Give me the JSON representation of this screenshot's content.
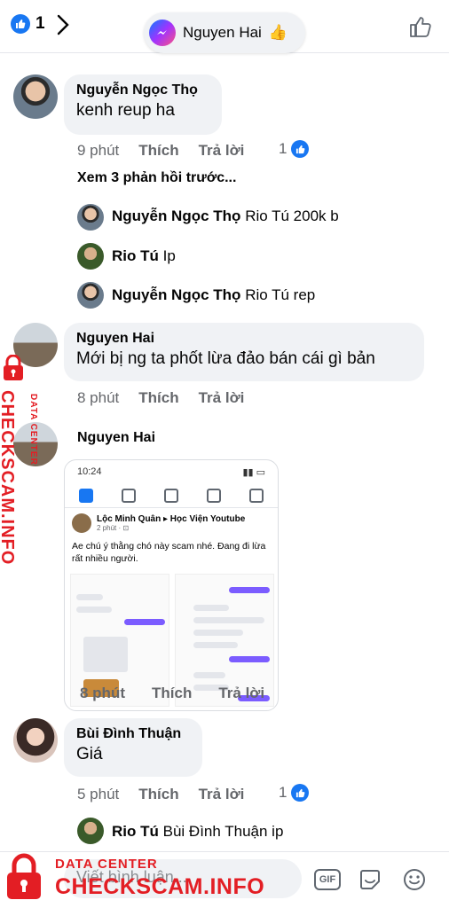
{
  "header": {
    "like_count": "1",
    "chat_head_name": "Nguyen Hai",
    "chat_head_emoji": "👍"
  },
  "comments": [
    {
      "name": "Nguyễn Ngọc Thọ",
      "text": "kenh reup ha",
      "time": "9 phút",
      "like_label": "Thích",
      "reply_label": "Trả lời",
      "reactions": "1"
    },
    {
      "name": "Nguyen Hai",
      "text": "Mới bị ng ta phốt lừa đảo bán cái gì bản",
      "time": "8 phút",
      "like_label": "Thích",
      "reply_label": "Trả lời"
    },
    {
      "name": "Nguyen Hai",
      "time": "8 phút",
      "like_label": "Thích",
      "reply_label": "Trả lời"
    },
    {
      "name": "Bùi Đình Thuận",
      "text": "Giá",
      "time": "5 phút",
      "like_label": "Thích",
      "reply_label": "Trả lời",
      "reactions": "1"
    }
  ],
  "see_previous": "Xem 3 phản hồi trước...",
  "replies": [
    {
      "name": "Nguyễn Ngọc Thọ",
      "text": "Rio Tú 200k b"
    },
    {
      "name": "Rio Tú",
      "text": "Ip"
    },
    {
      "name": "Nguyễn Ngọc Thọ",
      "text": "Rio Tú rep"
    },
    {
      "name": "Rio Tú",
      "text": "Bùi Đình Thuận ip"
    }
  ],
  "attachment": {
    "status_time": "10:24",
    "post_author": "Lộc Minh Quân ▸ Học Viện Youtube",
    "post_time": "2 phút · ⊡",
    "post_text": "Ae chú ý thằng chó này scam nhé. Đang đi lừa rất nhiều người."
  },
  "composer": {
    "placeholder": "Viết bình luận...",
    "gif_label": "GIF"
  },
  "watermark": {
    "sub": "DATA CENTER",
    "main": "CHECKSCAM.INFO"
  },
  "colors": {
    "brand_blue": "#1877f2",
    "watermark_red": "#e31e24",
    "bubble_gray": "#f0f2f5"
  }
}
